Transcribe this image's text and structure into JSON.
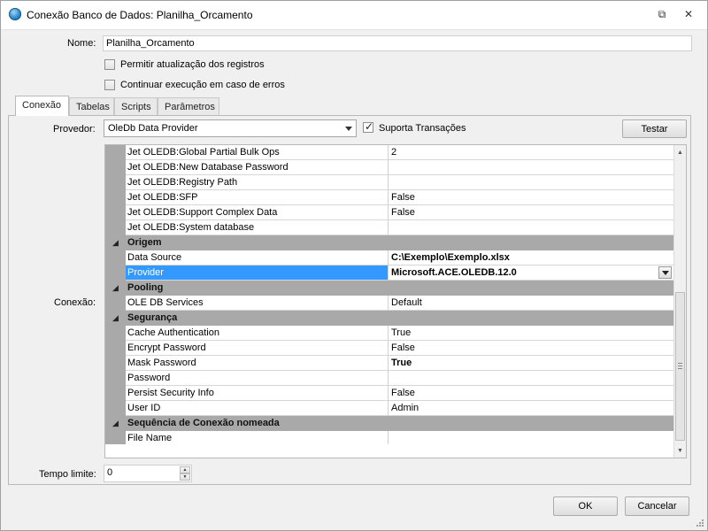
{
  "window": {
    "title": "Conexão Banco de Dados: Planilha_Orcamento",
    "restore_glyph": "⧉",
    "close_glyph": "✕"
  },
  "form": {
    "name_label": "Nome:",
    "name_value": "Planilha_Orcamento",
    "allow_update_label": "Permitir atualização dos registros",
    "continue_on_error_label": "Continuar execução em caso de erros"
  },
  "tabs": [
    {
      "label": "Conexão"
    },
    {
      "label": "Tabelas"
    },
    {
      "label": "Scripts"
    },
    {
      "label": "Parâmetros"
    }
  ],
  "connection": {
    "provider_label": "Provedor:",
    "provider_value": "OleDb Data Provider",
    "supports_transactions_label": "Suporta Transações",
    "test_button": "Testar",
    "connection_label": "Conexão:",
    "timeout_label": "Tempo limite:",
    "timeout_value": "0"
  },
  "grid": {
    "rows": [
      {
        "type": "prop",
        "name": "Jet OLEDB:Global Partial Bulk Ops",
        "value": "2"
      },
      {
        "type": "prop",
        "name": "Jet OLEDB:New Database Password",
        "value": ""
      },
      {
        "type": "prop",
        "name": "Jet OLEDB:Registry Path",
        "value": ""
      },
      {
        "type": "prop",
        "name": "Jet OLEDB:SFP",
        "value": "False"
      },
      {
        "type": "prop",
        "name": "Jet OLEDB:Support Complex Data",
        "value": "False"
      },
      {
        "type": "prop",
        "name": "Jet OLEDB:System database",
        "value": ""
      },
      {
        "type": "cat",
        "name": "Origem"
      },
      {
        "type": "prop",
        "name": "Data Source",
        "value": "C:\\Exemplo\\Exemplo.xlsx",
        "bold": true
      },
      {
        "type": "prop",
        "name": "Provider",
        "value": "Microsoft.ACE.OLEDB.12.0",
        "bold": true,
        "selected": true,
        "dropdown": true
      },
      {
        "type": "cat",
        "name": "Pooling"
      },
      {
        "type": "prop",
        "name": "OLE DB Services",
        "value": "Default"
      },
      {
        "type": "cat",
        "name": "Segurança"
      },
      {
        "type": "prop",
        "name": "Cache Authentication",
        "value": "True"
      },
      {
        "type": "prop",
        "name": "Encrypt Password",
        "value": "False"
      },
      {
        "type": "prop",
        "name": "Mask Password",
        "value": "True",
        "bold": true
      },
      {
        "type": "prop",
        "name": "Password",
        "value": ""
      },
      {
        "type": "prop",
        "name": "Persist Security Info",
        "value": "False"
      },
      {
        "type": "prop",
        "name": "User ID",
        "value": "Admin"
      },
      {
        "type": "cat",
        "name": "Sequência de Conexão nomeada"
      },
      {
        "type": "prop",
        "name": "File Name",
        "value": ""
      }
    ]
  },
  "footer": {
    "ok_button": "OK",
    "cancel_button": "Cancelar"
  }
}
